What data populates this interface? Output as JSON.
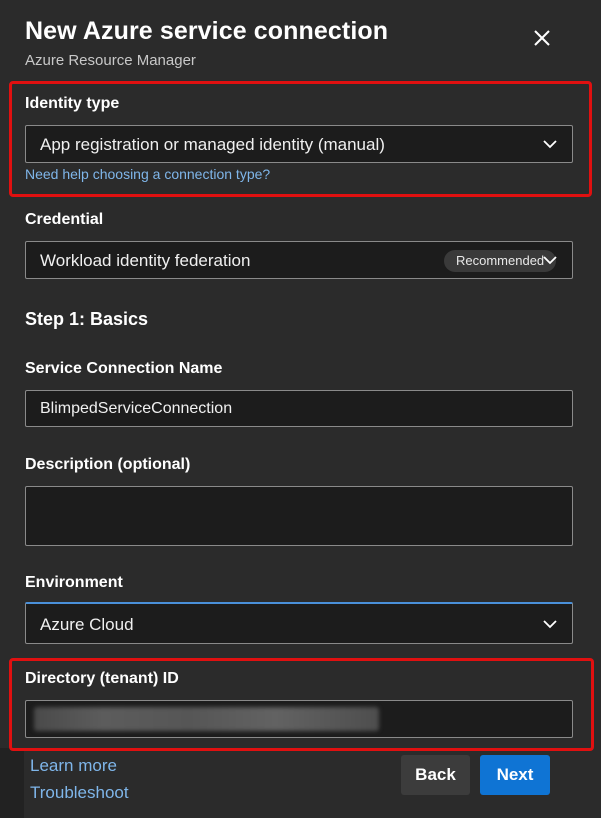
{
  "header": {
    "title": "New Azure service connection",
    "subtitle": "Azure Resource Manager"
  },
  "identity_type": {
    "label": "Identity type",
    "value": "App registration or managed identity (manual)",
    "help_link": "Need help choosing a connection type?"
  },
  "credential": {
    "label": "Credential",
    "value": "Workload identity federation",
    "badge": "Recommended"
  },
  "step": {
    "title": "Step 1: Basics"
  },
  "service_connection_name": {
    "label": "Service Connection Name",
    "value": "BlimpedServiceConnection"
  },
  "description": {
    "label": "Description (optional)",
    "value": ""
  },
  "environment": {
    "label": "Environment",
    "value": "Azure Cloud"
  },
  "tenant_id": {
    "label": "Directory (tenant) ID"
  },
  "footer": {
    "learn_more": "Learn more",
    "troubleshoot": "Troubleshoot",
    "back_label": "Back",
    "next_label": "Next"
  },
  "colors": {
    "background": "#2b2b2b",
    "field_background": "#1c1c1c",
    "link": "#7fb6ea",
    "highlight": "#e01010",
    "primary_button": "#0f74d4",
    "environment_focus": "#4a90d9"
  },
  "icons": {
    "close": "close-icon",
    "dropdown": "chevron-down-icon"
  }
}
